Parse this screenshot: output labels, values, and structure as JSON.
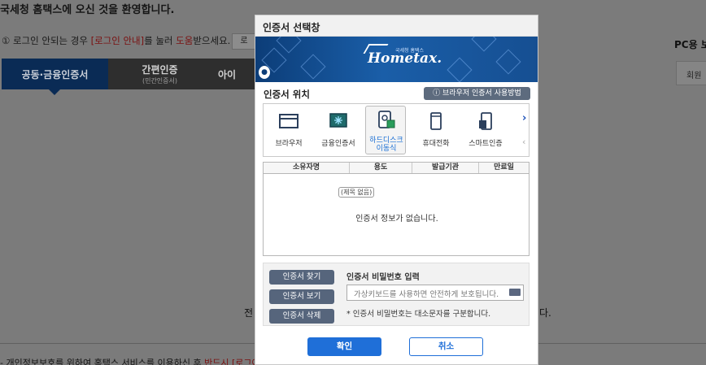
{
  "background": {
    "welcome": "국세청 홈택스에 오신 것을 환영합니다.",
    "notice_prefix": "① 로그인 안되는 경우 ",
    "notice_link": "[로그인 안내]",
    "notice_mid": "를 눌러 ",
    "notice_help": "도움",
    "notice_suffix": "받으세요.",
    "notice_button": "로",
    "pc_label": "PC용 보",
    "member_button": "회원",
    "tabs": [
      {
        "label": "공동·금융인증서"
      },
      {
        "label": "간편인증",
        "sub": "(민간인증서)"
      },
      {
        "label": "아이"
      }
    ],
    "bottom_left": "전",
    "bottom_right": "다.",
    "footer_prefix": "- 개인정보보호를 위하여 홈택스 서비스를 이용하신 후 ",
    "footer_red": "반드시 [로그아"
  },
  "dialog": {
    "title": "인증서 선택창",
    "banner": {
      "logo": "Hometax.",
      "logo_small": "국세청 홈택스"
    },
    "location_title": "인증서 위치",
    "howto_button": "ⓘ 브라우저 인증서 사용방법",
    "locations": [
      {
        "label": "브라우저",
        "icon": "browser-icon"
      },
      {
        "label": "금융인증서",
        "icon": "financial-cert-icon"
      },
      {
        "label": "하드디스크",
        "label2": "이동식",
        "icon": "harddisk-icon",
        "active": true
      },
      {
        "label": "휴대전화",
        "icon": "mobile-phone-icon"
      },
      {
        "label": "스마트인증",
        "icon": "smart-cert-icon"
      }
    ],
    "table": {
      "columns": [
        "소유자명",
        "용도",
        "발급기관",
        "만료일"
      ],
      "empty_badge": "(제목 없음)",
      "empty_message": "인증서 정보가 없습니다."
    },
    "buttons": {
      "find": "인증서 찾기",
      "view": "인증서 보기",
      "delete": "인증서 삭제",
      "ok": "확인",
      "cancel": "취소"
    },
    "password": {
      "title": "인증서 비밀번호 입력",
      "placeholder": "가상키보드를 사용하면 안전하게 보호됩니다.",
      "note": "* 인증서 비밀번호는 대소문자를 구분합니다."
    }
  }
}
